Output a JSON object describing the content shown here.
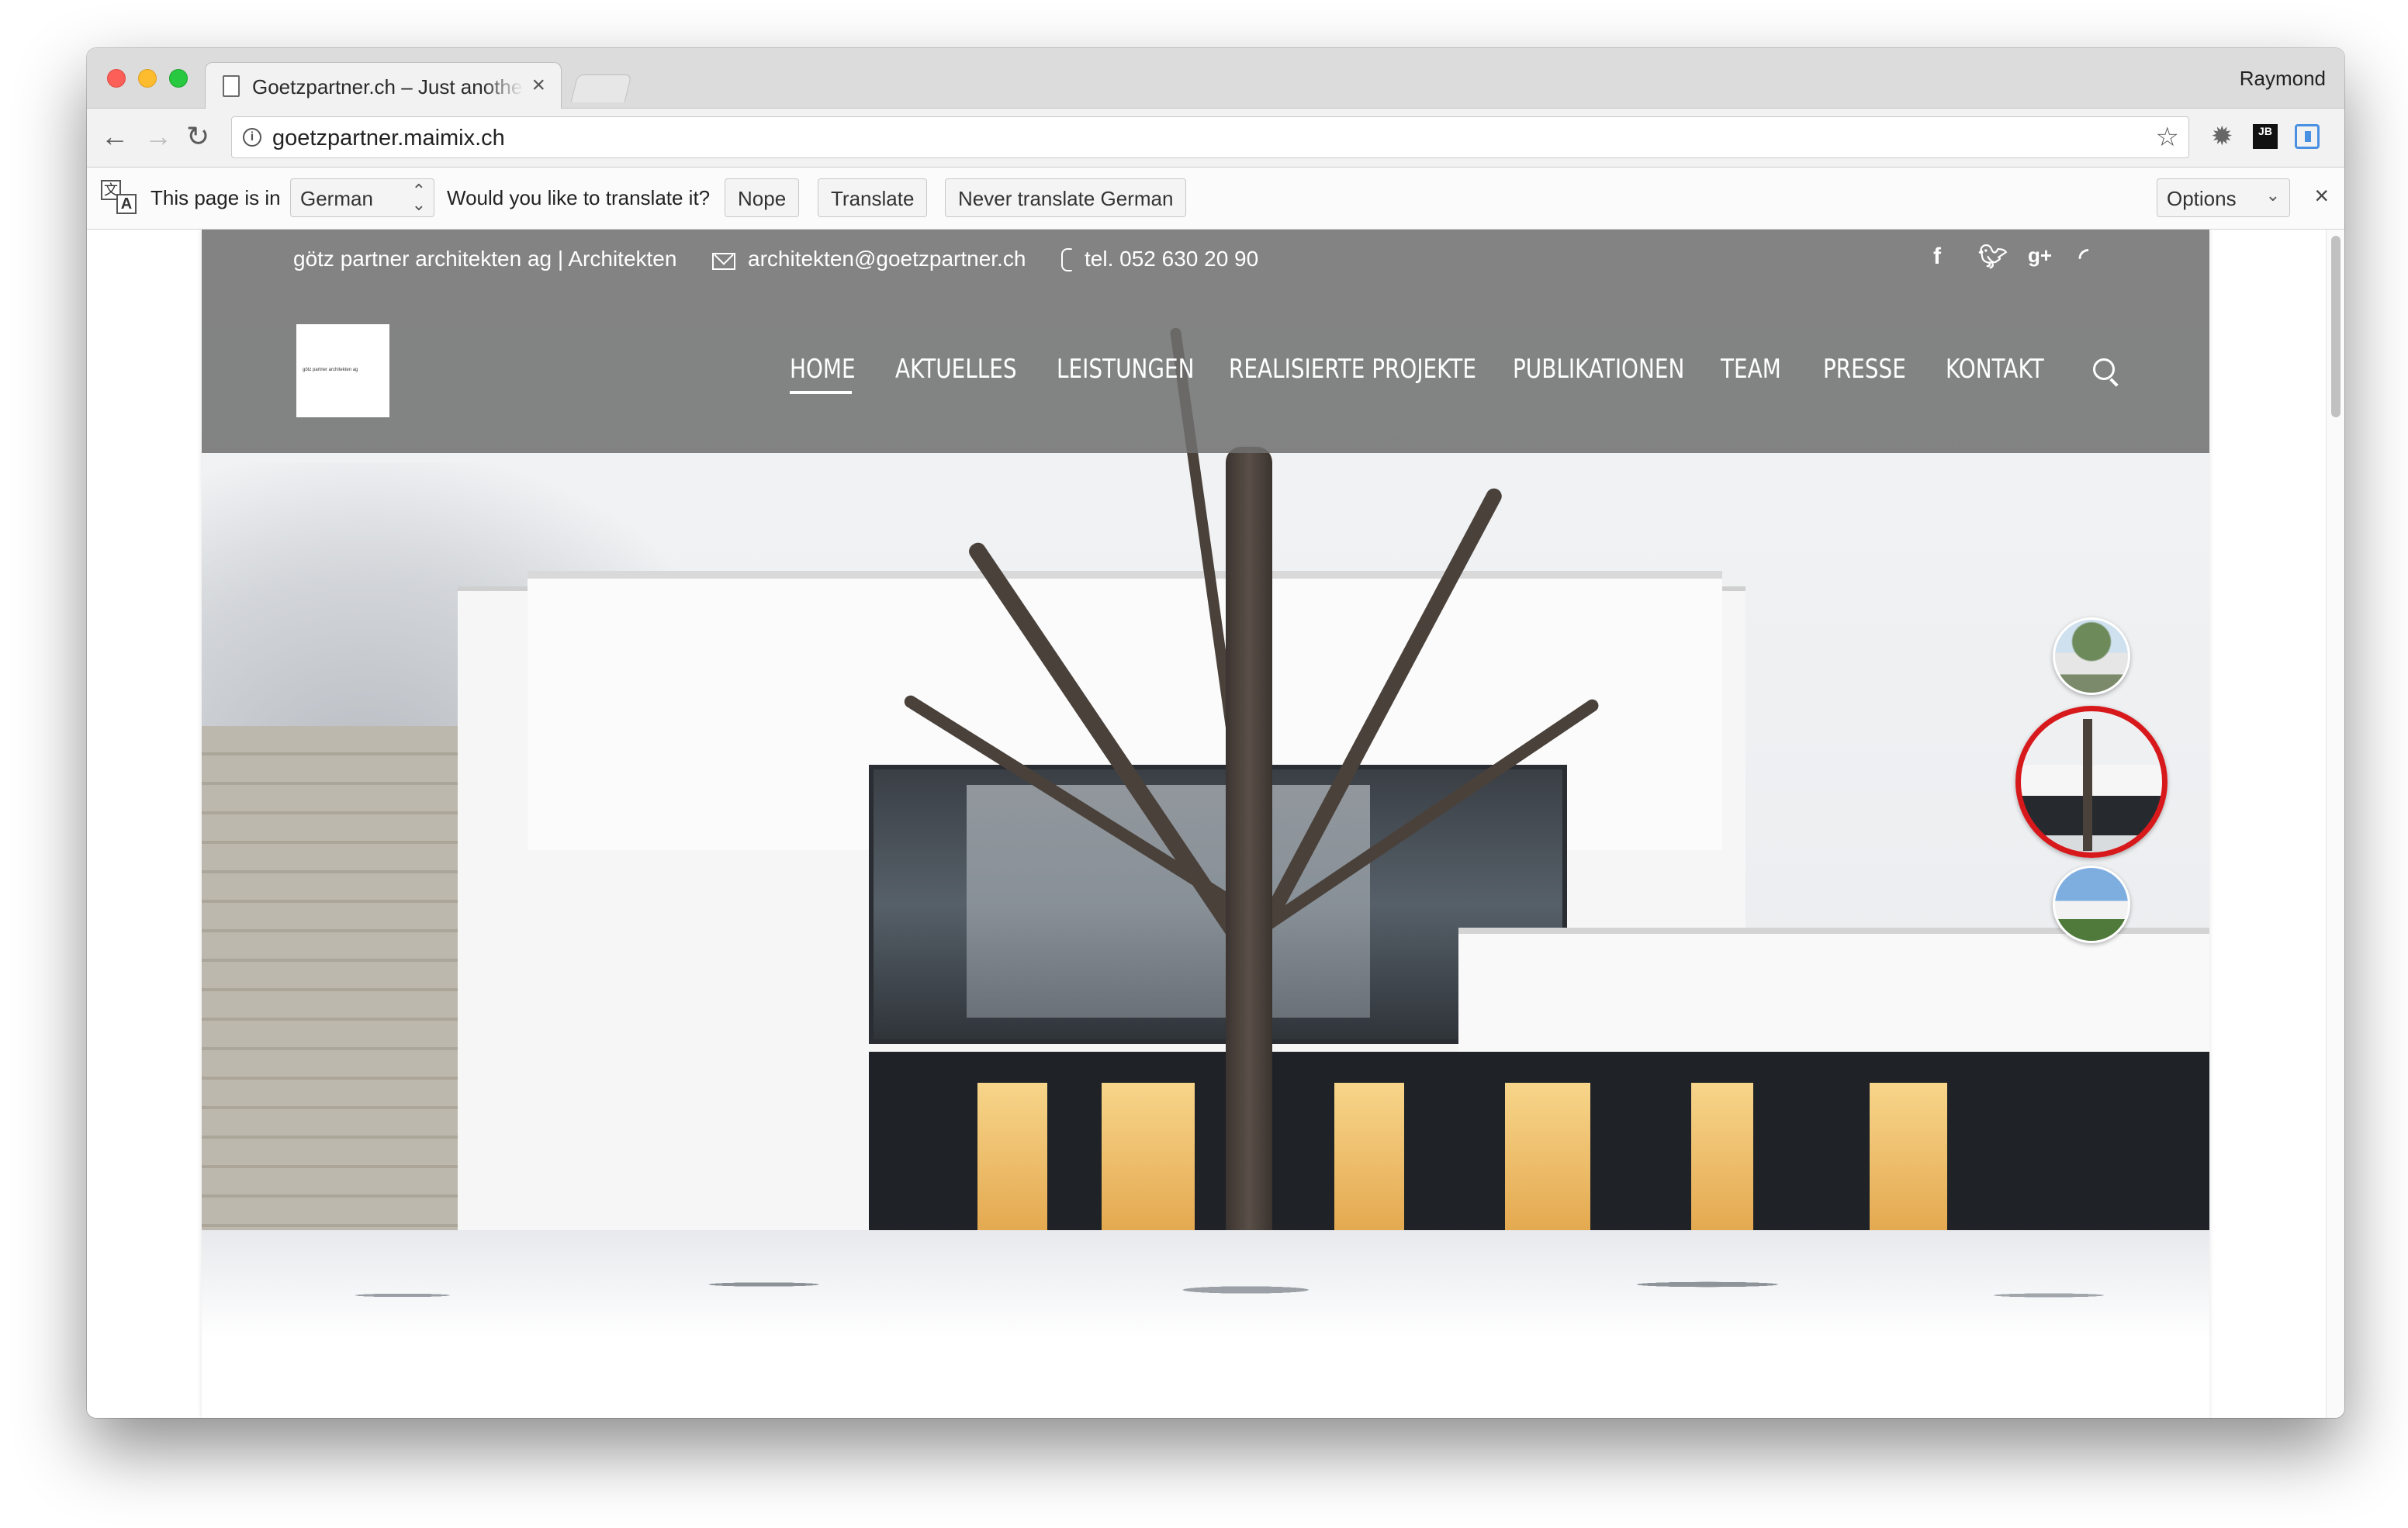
{
  "browser": {
    "tab_title": "Goetzpartner.ch – Just another",
    "tab_close": "×",
    "profile_name": "Raymond",
    "url": "goetzpartner.maimix.ch",
    "nav": {
      "back": "←",
      "forward": "→",
      "reload": "↻"
    },
    "bookmark_star": "☆",
    "extensions": {
      "jb_label": "JB"
    },
    "menu": "⋮"
  },
  "translate_bar": {
    "page_is_in": "This page is in",
    "language": "German",
    "question": "Would you like to translate it?",
    "nope": "Nope",
    "translate": "Translate",
    "never": "Never translate German",
    "options": "Options",
    "close": "×"
  },
  "site": {
    "topbar": {
      "company": "götz partner architekten ag | Architekten",
      "email": "architekten@goetzpartner.ch",
      "phone": "tel. 052 630 20 90",
      "social": [
        "f",
        "t",
        "g+",
        "rss"
      ]
    },
    "logo_text": "götz partner architekten ag",
    "nav": [
      "HOME",
      "AKTUELLES",
      "LEISTUNGEN",
      "REALISIERTE PROJEKTE",
      "PUBLIKATIONEN",
      "TEAM",
      "PRESSE",
      "KONTAKT"
    ],
    "active_nav": "HOME",
    "slider": {
      "slides": 3,
      "active_index": 1
    }
  },
  "colors": {
    "header_overlay": "#707070",
    "accent_active_thumb": "#d7191c",
    "nav_text": "#ffffff"
  }
}
